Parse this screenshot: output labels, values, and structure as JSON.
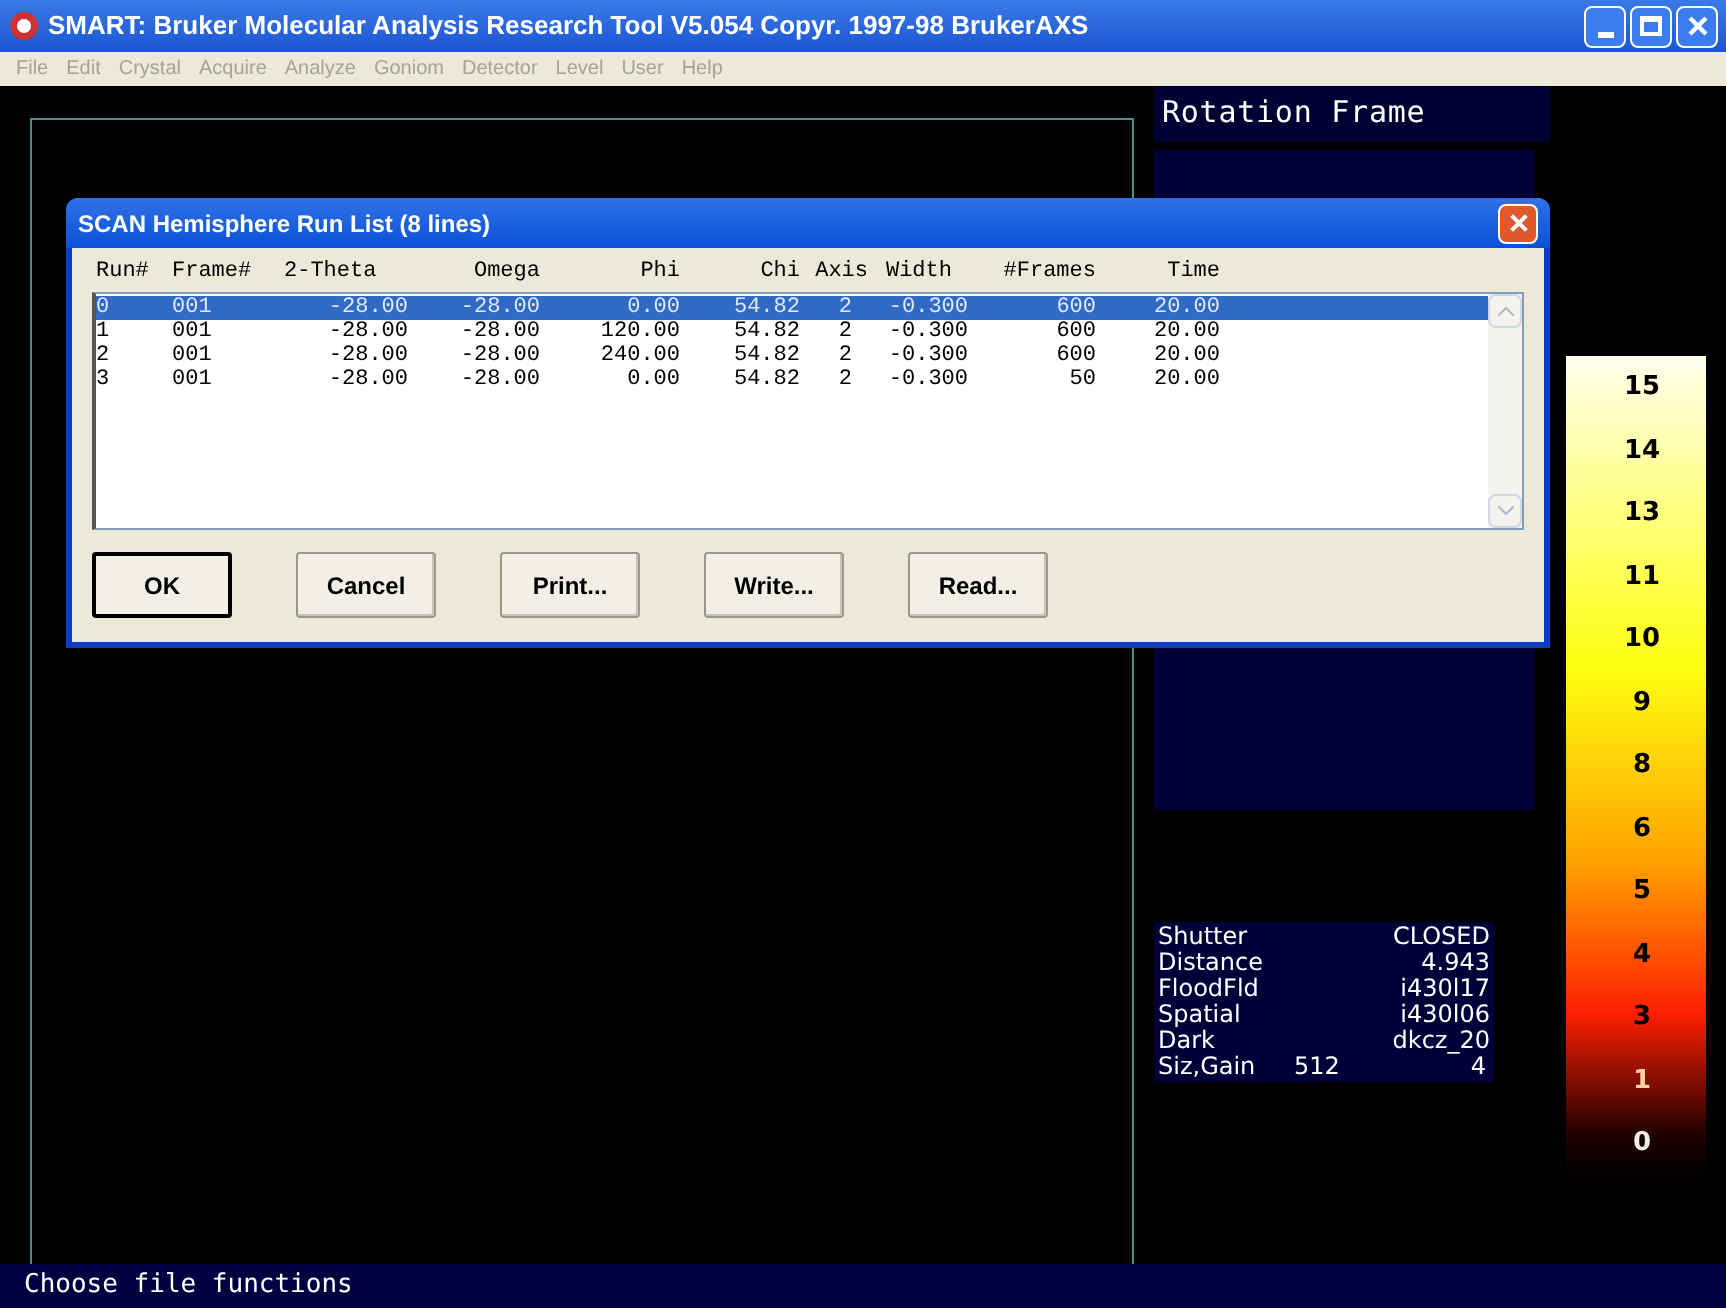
{
  "window": {
    "title": "SMART: Bruker Molecular Analysis Research Tool V5.054 Copyr. 1997-98 BrukerAXS"
  },
  "menu": [
    "File",
    "Edit",
    "Crystal",
    "Acquire",
    "Analyze",
    "Goniom",
    "Detector",
    "Level",
    "User",
    "Help"
  ],
  "side_panel": {
    "title": "Rotation Frame",
    "info": [
      {
        "label": "Shutter",
        "value": "CLOSED"
      },
      {
        "label": "Distance",
        "value": "4.943"
      },
      {
        "label": "FloodFld",
        "value": "i430l17"
      },
      {
        "label": "Spatial",
        "value": "i430l06"
      },
      {
        "label": "Dark",
        "value": "dkcz_20"
      },
      {
        "label": "Siz,Gain",
        "value": "512",
        "value_2": "4"
      }
    ]
  },
  "color_scale": [
    "15",
    "14",
    "13",
    "11",
    "10",
    "9",
    "8",
    "6",
    "5",
    "4",
    "3",
    "1",
    "0"
  ],
  "dialog": {
    "title": "SCAN Hemisphere Run List (8 lines)",
    "columns": [
      "Run#",
      "Frame#",
      "2-Theta",
      "Omega",
      "Phi",
      "Chi",
      "Axis",
      "Width",
      "#Frames",
      "Time"
    ],
    "rows": [
      {
        "selected": true,
        "cells": [
          "0",
          "001",
          "-28.00",
          "-28.00",
          "0.00",
          "54.82",
          "2",
          "-0.300",
          "600",
          "20.00"
        ]
      },
      {
        "selected": false,
        "cells": [
          "1",
          "001",
          "-28.00",
          "-28.00",
          "120.00",
          "54.82",
          "2",
          "-0.300",
          "600",
          "20.00"
        ]
      },
      {
        "selected": false,
        "cells": [
          "2",
          "001",
          "-28.00",
          "-28.00",
          "240.00",
          "54.82",
          "2",
          "-0.300",
          "600",
          "20.00"
        ]
      },
      {
        "selected": false,
        "cells": [
          "3",
          "001",
          "-28.00",
          "-28.00",
          "0.00",
          "54.82",
          "2",
          "-0.300",
          "50",
          "20.00"
        ]
      }
    ],
    "buttons": [
      {
        "label": "OK",
        "default": true
      },
      {
        "label": "Cancel",
        "default": false
      },
      {
        "label": "Print...",
        "default": false
      },
      {
        "label": "Write...",
        "default": false
      },
      {
        "label": "Read...",
        "default": false
      }
    ]
  },
  "status_bar": "Choose file functions"
}
